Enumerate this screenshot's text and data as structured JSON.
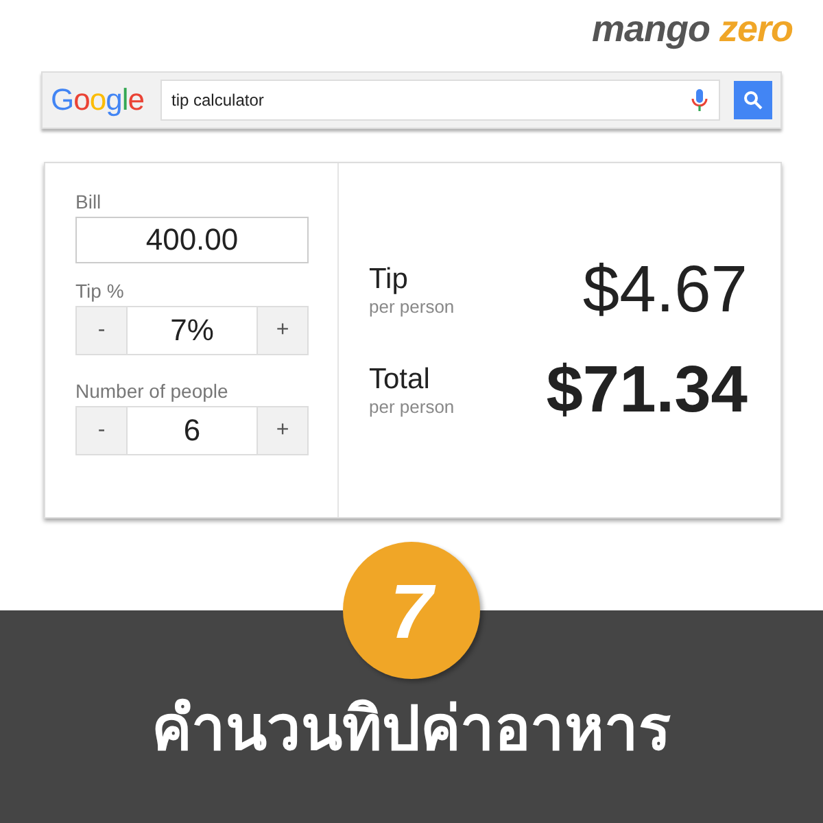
{
  "brand": {
    "first": "mango",
    "second": "zero"
  },
  "search": {
    "logo": [
      {
        "char": "G",
        "color": "#4285f4"
      },
      {
        "char": "o",
        "color": "#ea4335"
      },
      {
        "char": "o",
        "color": "#fbbc05"
      },
      {
        "char": "g",
        "color": "#4285f4"
      },
      {
        "char": "l",
        "color": "#34a853"
      },
      {
        "char": "e",
        "color": "#ea4335"
      }
    ],
    "value": "tip calculator"
  },
  "calculator": {
    "bill": {
      "label": "Bill",
      "value": "400.00"
    },
    "steppers": [
      {
        "label": "Tip %",
        "value": "7%",
        "minus": "-",
        "plus": "+"
      },
      {
        "label": "Number of people",
        "value": "6",
        "minus": "-",
        "plus": "+"
      }
    ],
    "results": [
      {
        "label": "Tip",
        "sub": "per person",
        "amount": "$4.67",
        "bold": false
      },
      {
        "label": "Total",
        "sub": "per person",
        "amount": "$71.34",
        "bold": true
      }
    ]
  },
  "badge": "7",
  "title": "คำนวนทิปค่าอาหาร"
}
